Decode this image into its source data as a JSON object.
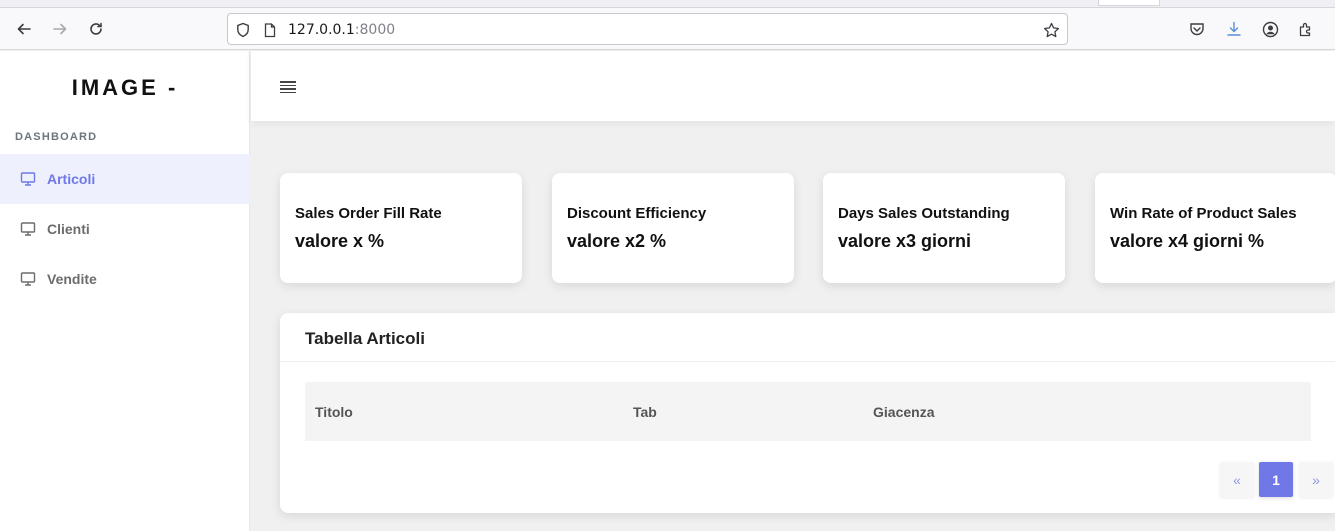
{
  "browser": {
    "url_host": "127.0.0.1",
    "url_port": ":8000"
  },
  "sidebar": {
    "brand": "IMAGE -",
    "section_label": "DASHBOARD",
    "items": [
      {
        "label": "Articoli",
        "icon": "monitor-icon",
        "active": true
      },
      {
        "label": "Clienti",
        "icon": "monitor-icon",
        "active": false
      },
      {
        "label": "Vendite",
        "icon": "monitor-icon",
        "active": false
      }
    ]
  },
  "cards": [
    {
      "title": "Sales Order Fill Rate",
      "value": "valore x %"
    },
    {
      "title": "Discount Efficiency",
      "value": "valore x2 %"
    },
    {
      "title": "Days Sales Outstanding",
      "value": "valore x3 giorni"
    },
    {
      "title": "Win Rate of Product Sales",
      "value": "valore x4 giorni %"
    }
  ],
  "table": {
    "title": "Tabella Articoli",
    "columns": [
      "Titolo",
      "Tab",
      "Giacenza"
    ],
    "rows": []
  },
  "pagination": {
    "prev": "«",
    "current": "1",
    "next": "»"
  },
  "colors": {
    "accent": "#6f78e6",
    "active_bg": "#eef0fe"
  }
}
